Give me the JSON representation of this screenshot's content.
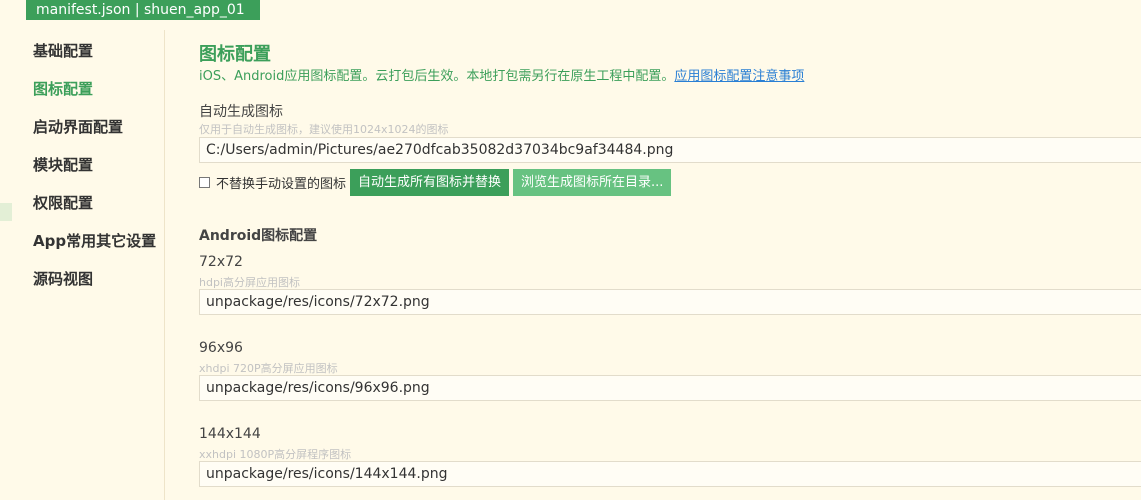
{
  "tab": {
    "title": "manifest.json | shuen_app_01"
  },
  "sidebar": {
    "items": [
      {
        "label": "基础配置"
      },
      {
        "label": "图标配置"
      },
      {
        "label": "启动界面配置"
      },
      {
        "label": "模块配置"
      },
      {
        "label": "权限配置"
      },
      {
        "label": "App常用其它设置"
      },
      {
        "label": "源码视图"
      }
    ],
    "active_index": 1
  },
  "page": {
    "title": "图标配置",
    "description": "iOS、Android应用图标配置。云打包后生效。本地打包需另行在原生工程中配置。",
    "doc_link": "应用图标配置注意事项"
  },
  "auto_generate": {
    "label": "自动生成图标",
    "hint": "仅用于自动生成图标，建议使用1024x1024的图标",
    "path": "C:/Users/admin/Pictures/ae270dfcab35082d37034bc9af34484.png",
    "checkbox_label": "不替换手动设置的图标",
    "checkbox_checked": false,
    "generate_button": "自动生成所有图标并替换",
    "browse_button": "浏览生成图标所在目录..."
  },
  "android": {
    "heading": "Android图标配置",
    "icons": [
      {
        "size": "72x72",
        "hint": "hdpi高分屏应用图标",
        "path": "unpackage/res/icons/72x72.png"
      },
      {
        "size": "96x96",
        "hint": "xhdpi 720P高分屏应用图标",
        "path": "unpackage/res/icons/96x96.png"
      },
      {
        "size": "144x144",
        "hint": "xxhdpi 1080P高分屏程序图标",
        "path": "unpackage/res/icons/144x144.png"
      }
    ]
  },
  "colors": {
    "accent": "#3c9f5a",
    "accent_light": "#67c281",
    "background": "#fffae9",
    "link": "#2a7fd4"
  }
}
